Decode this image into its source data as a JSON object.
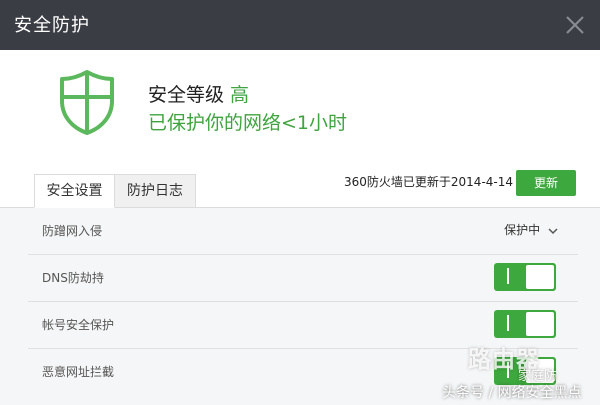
{
  "window": {
    "title": "安全防护"
  },
  "status": {
    "level_label": "安全等级",
    "level_value": "高",
    "protect_text": "已保护你的网络<1小时"
  },
  "tabs": [
    {
      "label": "安全设置",
      "active": true
    },
    {
      "label": "防护日志",
      "active": false
    }
  ],
  "update": {
    "text": "360防火墙已更新于2014-4-14",
    "button": "更新"
  },
  "settings": [
    {
      "label": "防蹭网入侵",
      "control": "dropdown",
      "value": "保护中"
    },
    {
      "label": "DNS防劫持",
      "control": "toggle",
      "on": true
    },
    {
      "label": "帐号安全保护",
      "control": "toggle",
      "on": true
    },
    {
      "label": "恶意网址拦截",
      "control": "toggle",
      "on": true
    }
  ],
  "watermark": {
    "line1": "路由器",
    "line2": "家庭防",
    "line3": "头条号 / 网络安全黑点"
  },
  "colors": {
    "accent": "#3da83d",
    "titlebar": "#3b3d45"
  },
  "icons": {
    "shield": "shield-icon",
    "close": "close-icon",
    "chevron": "chevron-down-icon"
  }
}
